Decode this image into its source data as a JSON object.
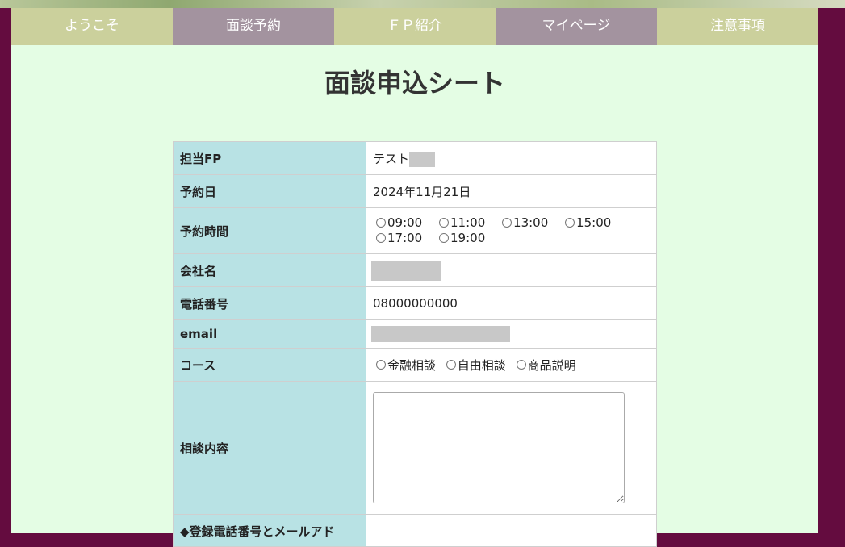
{
  "nav": {
    "items": [
      {
        "label": "ようこそ"
      },
      {
        "label": "面談予約"
      },
      {
        "label": "ＦＰ紹介"
      },
      {
        "label": "マイページ"
      },
      {
        "label": "注意事項"
      }
    ]
  },
  "page_title": "面談申込シート",
  "form": {
    "fp": {
      "label": "担当FP",
      "value": "テスト"
    },
    "date": {
      "label": "予約日",
      "value": "2024年11月21日"
    },
    "time": {
      "label": "予約時間",
      "options": [
        "09:00",
        "11:00",
        "13:00",
        "15:00",
        "17:00",
        "19:00"
      ]
    },
    "company": {
      "label": "会社名"
    },
    "phone": {
      "label": "電話番号",
      "value": "08000000000"
    },
    "email": {
      "label": "email"
    },
    "course": {
      "label": "コース",
      "options": [
        "金融相談",
        "自由相談",
        "商品説明"
      ]
    },
    "consult": {
      "label": "相談内容"
    },
    "note": {
      "label": "◆登録電話番号とメールアド"
    }
  }
}
